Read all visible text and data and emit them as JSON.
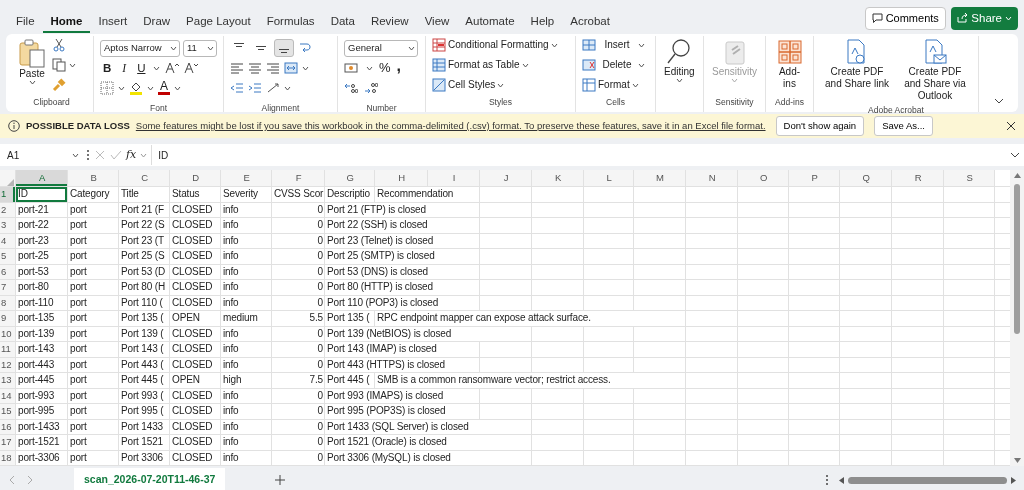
{
  "menu_tabs": [
    {
      "label": "File",
      "selected": false
    },
    {
      "label": "Home",
      "selected": true
    },
    {
      "label": "Insert",
      "selected": false
    },
    {
      "label": "Draw",
      "selected": false
    },
    {
      "label": "Page Layout",
      "selected": false
    },
    {
      "label": "Formulas",
      "selected": false
    },
    {
      "label": "Data",
      "selected": false
    },
    {
      "label": "Review",
      "selected": false
    },
    {
      "label": "View",
      "selected": false
    },
    {
      "label": "Automate",
      "selected": false
    },
    {
      "label": "Help",
      "selected": false
    },
    {
      "label": "Acrobat",
      "selected": false
    }
  ],
  "comments_button": "Comments",
  "share_button": "Share",
  "ribbon": {
    "clipboard": {
      "paste": "Paste",
      "label": "Clipboard"
    },
    "font": {
      "name": "Aptos Narrow",
      "size": "11",
      "buttons": [
        "B",
        "I",
        "U"
      ],
      "font_color": "A",
      "label": "Font"
    },
    "alignment": {
      "vertical": [
        {
          "selected": false
        },
        {
          "selected": false
        },
        {
          "selected": true
        }
      ],
      "label": "Alignment"
    },
    "number": {
      "format": "General",
      "percent": "%",
      "comma": ",",
      "label": "Number"
    },
    "styles": {
      "items": [
        "Conditional Formatting",
        "Format as Table",
        "Cell Styles"
      ],
      "label": "Styles"
    },
    "cells": {
      "items": [
        "Insert",
        "Delete",
        "Format"
      ],
      "label": "Cells"
    },
    "editing": {
      "button": "Editing"
    },
    "sensitivity": {
      "button": "Sensitivity",
      "disabled": true,
      "label": "Sensitivity"
    },
    "addins": {
      "button": "Add-ins",
      "label": "Add-ins"
    },
    "acrobat": {
      "items": [
        "Create PDF and Share link",
        "Create PDF and Share via Outlook"
      ],
      "label": "Adobe Acrobat"
    }
  },
  "info_bar": {
    "title": "POSSIBLE DATA LOSS",
    "message": "Some features might be lost if you save this workbook in the comma-delimited (.csv) format. To preserve these features, save it in an Excel file format.",
    "buttons": [
      "Don't show again",
      "Save As..."
    ]
  },
  "formula_bar": {
    "name_box": "A1",
    "function_label": "fx",
    "value": "ID"
  },
  "sheet": {
    "columns": [
      {
        "label": "A",
        "selected": true
      },
      {
        "label": "B",
        "selected": false
      },
      {
        "label": "C",
        "selected": false
      },
      {
        "label": "D",
        "selected": false
      },
      {
        "label": "E",
        "selected": false
      },
      {
        "label": "F",
        "selected": false
      },
      {
        "label": "G",
        "selected": false
      },
      {
        "label": "H",
        "selected": false
      },
      {
        "label": "I",
        "selected": false
      },
      {
        "label": "J",
        "selected": false
      },
      {
        "label": "K",
        "selected": false
      },
      {
        "label": "L",
        "selected": false
      },
      {
        "label": "M",
        "selected": false
      },
      {
        "label": "N",
        "selected": false
      },
      {
        "label": "O",
        "selected": false
      },
      {
        "label": "P",
        "selected": false
      },
      {
        "label": "Q",
        "selected": false
      },
      {
        "label": "R",
        "selected": false
      },
      {
        "label": "S",
        "selected": false
      }
    ],
    "rows": [
      {
        "number": "1",
        "selected": true,
        "cells": [
          "ID",
          "Category",
          "Title",
          "Status",
          "Severity",
          "CVSS Scor",
          "Descriptio",
          "Recommendation"
        ]
      },
      {
        "number": "2",
        "selected": false,
        "cells": [
          "port-21",
          "port",
          "Port 21 (F",
          "CLOSED",
          "info",
          "0",
          "Port 21 (FTP) is closed"
        ]
      },
      {
        "number": "3",
        "selected": false,
        "cells": [
          "port-22",
          "port",
          "Port 22 (S",
          "CLOSED",
          "info",
          "0",
          "Port 22 (SSH) is closed"
        ]
      },
      {
        "number": "4",
        "selected": false,
        "cells": [
          "port-23",
          "port",
          "Port 23 (T",
          "CLOSED",
          "info",
          "0",
          "Port 23 (Telnet) is closed"
        ]
      },
      {
        "number": "5",
        "selected": false,
        "cells": [
          "port-25",
          "port",
          "Port 25 (S",
          "CLOSED",
          "info",
          "0",
          "Port 25 (SMTP) is closed"
        ]
      },
      {
        "number": "6",
        "selected": false,
        "cells": [
          "port-53",
          "port",
          "Port 53 (D",
          "CLOSED",
          "info",
          "0",
          "Port 53 (DNS) is closed"
        ]
      },
      {
        "number": "7",
        "selected": false,
        "cells": [
          "port-80",
          "port",
          "Port 80 (H",
          "CLOSED",
          "info",
          "0",
          "Port 80 (HTTP) is closed"
        ]
      },
      {
        "number": "8",
        "selected": false,
        "cells": [
          "port-110",
          "port",
          "Port 110 (",
          "CLOSED",
          "info",
          "0",
          "Port 110 (POP3) is closed"
        ]
      },
      {
        "number": "9",
        "selected": false,
        "cells": [
          "port-135",
          "port",
          "Port 135 (",
          "OPEN",
          "medium",
          "5.5",
          "Port 135 (",
          "RPC endpoint mapper can expose attack surface."
        ]
      },
      {
        "number": "10",
        "selected": false,
        "cells": [
          "port-139",
          "port",
          "Port 139 (",
          "CLOSED",
          "info",
          "0",
          "Port 139 (NetBIOS) is closed"
        ]
      },
      {
        "number": "11",
        "selected": false,
        "cells": [
          "port-143",
          "port",
          "Port 143 (",
          "CLOSED",
          "info",
          "0",
          "Port 143 (IMAP) is closed"
        ]
      },
      {
        "number": "12",
        "selected": false,
        "cells": [
          "port-443",
          "port",
          "Port 443 (",
          "CLOSED",
          "info",
          "0",
          "Port 443 (HTTPS) is closed"
        ]
      },
      {
        "number": "13",
        "selected": false,
        "cells": [
          "port-445",
          "port",
          "Port 445 (",
          "OPEN",
          "high",
          "7.5",
          "Port 445 (",
          "SMB is a common ransomware vector; restrict access."
        ]
      },
      {
        "number": "14",
        "selected": false,
        "cells": [
          "port-993",
          "port",
          "Port 993 (",
          "CLOSED",
          "info",
          "0",
          "Port 993 (IMAPS) is closed"
        ]
      },
      {
        "number": "15",
        "selected": false,
        "cells": [
          "port-995",
          "port",
          "Port 995 (",
          "CLOSED",
          "info",
          "0",
          "Port 995 (POP3S) is closed"
        ]
      },
      {
        "number": "16",
        "selected": false,
        "cells": [
          "port-1433",
          "port",
          "Port 1433",
          "CLOSED",
          "info",
          "0",
          "Port 1433 (SQL Server) is closed"
        ]
      },
      {
        "number": "17",
        "selected": false,
        "cells": [
          "port-1521",
          "port",
          "Port 1521",
          "CLOSED",
          "info",
          "0",
          "Port 1521 (Oracle) is closed"
        ]
      },
      {
        "number": "18",
        "selected": false,
        "cells": [
          "port-3306",
          "port",
          "Port 3306",
          "CLOSED",
          "info",
          "0",
          "Port 3306 (MySQL) is closed"
        ]
      }
    ]
  },
  "sheet_tabs": [
    {
      "label": "scan_2026-07-20T11-46-37",
      "selected": true
    }
  ]
}
